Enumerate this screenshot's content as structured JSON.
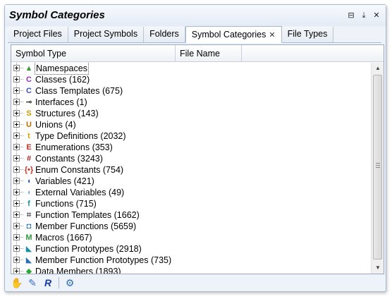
{
  "window": {
    "title": "Symbol Categories"
  },
  "title_buttons": [
    "⊟",
    "⤓",
    "✕"
  ],
  "tabs": [
    {
      "label": "Project Files"
    },
    {
      "label": "Project Symbols"
    },
    {
      "label": "Folders"
    },
    {
      "label": "Symbol Categories",
      "active": true
    },
    {
      "label": "File Types"
    }
  ],
  "columns": [
    "Symbol Type",
    "File Name"
  ],
  "tree": [
    {
      "label": "Namespaces",
      "icon": "namespace-icon",
      "glyph": "▲",
      "color": "#3a9a3a"
    },
    {
      "label": "Classes (162)",
      "icon": "class-icon",
      "glyph": "C",
      "color": "#9b2fb5"
    },
    {
      "label": "Class Templates (675)",
      "icon": "class-template-icon",
      "glyph": "C",
      "color": "#3b4fbf"
    },
    {
      "label": "Interfaces (1)",
      "icon": "interface-icon",
      "glyph": "⊸",
      "color": "#222222"
    },
    {
      "label": "Structures (143)",
      "icon": "structure-icon",
      "glyph": "S",
      "color": "#c79a00"
    },
    {
      "label": "Unions (4)",
      "icon": "union-icon",
      "glyph": "U",
      "color": "#c06a00"
    },
    {
      "label": "Type Definitions (2032)",
      "icon": "typedef-icon",
      "glyph": "t",
      "color": "#d4a400"
    },
    {
      "label": "Enumerations (353)",
      "icon": "enumeration-icon",
      "glyph": "E",
      "color": "#c0352a"
    },
    {
      "label": "Constants (3243)",
      "icon": "constant-icon",
      "glyph": "#",
      "color": "#a52a2a"
    },
    {
      "label": "Enum Constants (754)",
      "icon": "enum-constant-icon",
      "glyph": "{•}",
      "color": "#c0352a"
    },
    {
      "label": "Variables (421)",
      "icon": "variable-icon",
      "glyph": "◖",
      "color": "#1f5fc8"
    },
    {
      "label": "External Variables (49)",
      "icon": "external-variable-icon",
      "glyph": "◖",
      "color": "#7fa6d6"
    },
    {
      "label": "Functions (715)",
      "icon": "function-icon",
      "glyph": "f",
      "color": "#1a8fa8"
    },
    {
      "label": "Function Templates (1662)",
      "icon": "function-template-icon",
      "glyph": "⌗",
      "color": "#555555"
    },
    {
      "label": "Member Functions (5659)",
      "icon": "member-function-icon",
      "glyph": "◘",
      "color": "#2a6fb8"
    },
    {
      "label": "Macros (1667)",
      "icon": "macro-icon",
      "glyph": "M",
      "color": "#2f9a3a"
    },
    {
      "label": "Function Prototypes (2918)",
      "icon": "function-prototype-icon",
      "glyph": "◣",
      "color": "#1a8fa8"
    },
    {
      "label": "Member Function Prototypes (735)",
      "icon": "member-function-prototype-icon",
      "glyph": "◣",
      "color": "#2a6fb8"
    },
    {
      "label": "Data Members (1893)",
      "icon": "data-member-icon",
      "glyph": "◆",
      "color": "#2fa83a"
    }
  ],
  "toolbar": [
    {
      "icon": "hand-icon",
      "glyph": "✋",
      "color": "#c07a20"
    },
    {
      "icon": "new-item-icon",
      "glyph": "✎",
      "color": "#3a6fc8"
    },
    {
      "icon": "r-icon",
      "glyph": "R",
      "color": "#1a3aa8"
    },
    {
      "icon": "gear-icon",
      "glyph": "⚙",
      "color": "#2a6fb8"
    }
  ]
}
